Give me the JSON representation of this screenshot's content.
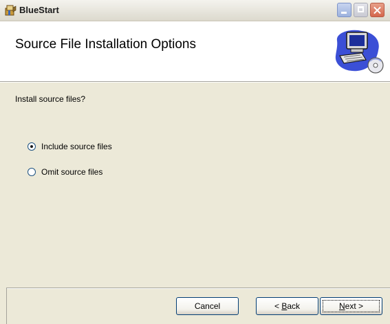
{
  "window": {
    "title": "BlueStart"
  },
  "header": {
    "title": "Source File Installation Options"
  },
  "body": {
    "question": "Install source files?",
    "options": [
      {
        "label": "Include source files",
        "checked": true
      },
      {
        "label": "Omit source files",
        "checked": false
      }
    ]
  },
  "buttons": {
    "cancel": "Cancel",
    "back_prefix": "< ",
    "back_mnemonic": "B",
    "back_rest": "ack",
    "next_mnemonic": "N",
    "next_rest": "ext >"
  }
}
